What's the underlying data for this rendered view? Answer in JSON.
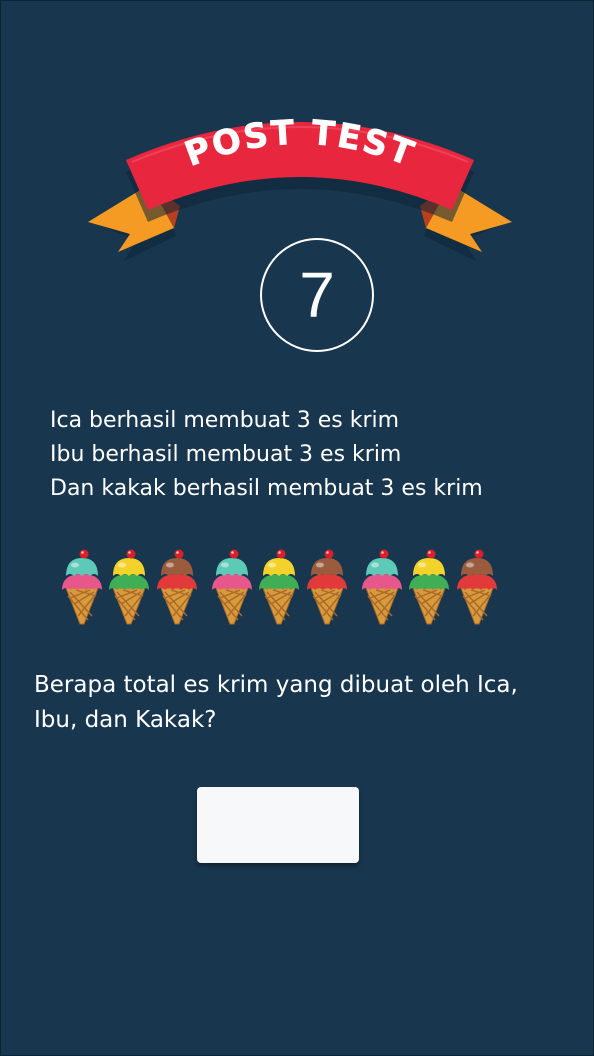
{
  "banner": {
    "title": "POST TEST",
    "ribbon_color": "#e8273f",
    "tail_color": "#f59b23"
  },
  "question_number": "7",
  "story_lines": [
    "Ica berhasil membuat 3 es krim",
    "Ibu berhasil membuat 3 es krim",
    "Dan kakak berhasil membuat 3 es krim"
  ],
  "ice_creams": [
    {
      "icon": "ice-cream-icon",
      "scoops": [
        "#e8578c",
        "#5fc9b8"
      ]
    },
    {
      "icon": "ice-cream-icon",
      "scoops": [
        "#3fae55",
        "#f3d22b"
      ]
    },
    {
      "icon": "ice-cream-icon",
      "scoops": [
        "#e23a3a",
        "#9a5c3c"
      ]
    },
    {
      "icon": "ice-cream-icon",
      "scoops": [
        "#e8578c",
        "#5fc9b8"
      ]
    },
    {
      "icon": "ice-cream-icon",
      "scoops": [
        "#3fae55",
        "#f3d22b"
      ]
    },
    {
      "icon": "ice-cream-icon",
      "scoops": [
        "#e23a3a",
        "#9a5c3c"
      ]
    },
    {
      "icon": "ice-cream-icon",
      "scoops": [
        "#e8578c",
        "#5fc9b8"
      ]
    },
    {
      "icon": "ice-cream-icon",
      "scoops": [
        "#3fae55",
        "#f3d22b"
      ]
    },
    {
      "icon": "ice-cream-icon",
      "scoops": [
        "#e23a3a",
        "#9a5c3c"
      ]
    }
  ],
  "question_lines": [
    "Berapa total es krim yang dibuat oleh Ica,",
    "Ibu, dan Kakak?"
  ],
  "answer": {
    "value": ""
  },
  "colors": {
    "background": "#18364e",
    "text": "#ffffff",
    "answer_box": "#f7f8fa"
  }
}
